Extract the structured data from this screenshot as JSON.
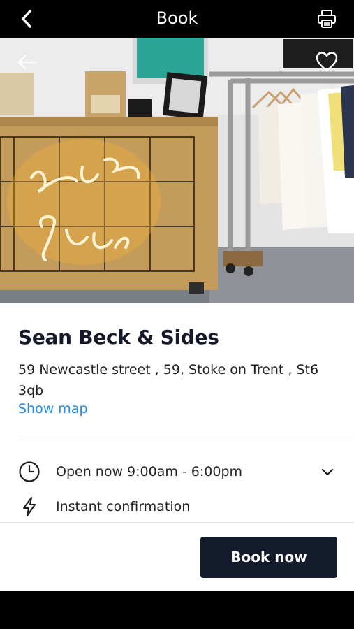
{
  "header": {
    "title": "Book"
  },
  "venue": {
    "name": "Sean Beck & Sides",
    "address": "59 Newcastle street , 59, Stoke on Trent , St6 3qb",
    "show_map_label": "Show map"
  },
  "details": {
    "hours_text": "Open now 9:00am - 6:00pm",
    "instant_text": "Instant confirmation"
  },
  "actions": {
    "book_now_label": "Book now"
  },
  "icons": {
    "back": "chevron-left-icon",
    "print": "printer-icon",
    "hero_back": "arrow-left-icon",
    "favorite": "heart-icon",
    "clock": "clock-icon",
    "bolt": "lightning-icon",
    "expand": "chevron-down-icon"
  },
  "colors": {
    "accent_link": "#1f8be6",
    "button_bg": "#131a2b",
    "bar_bg": "#000000"
  }
}
